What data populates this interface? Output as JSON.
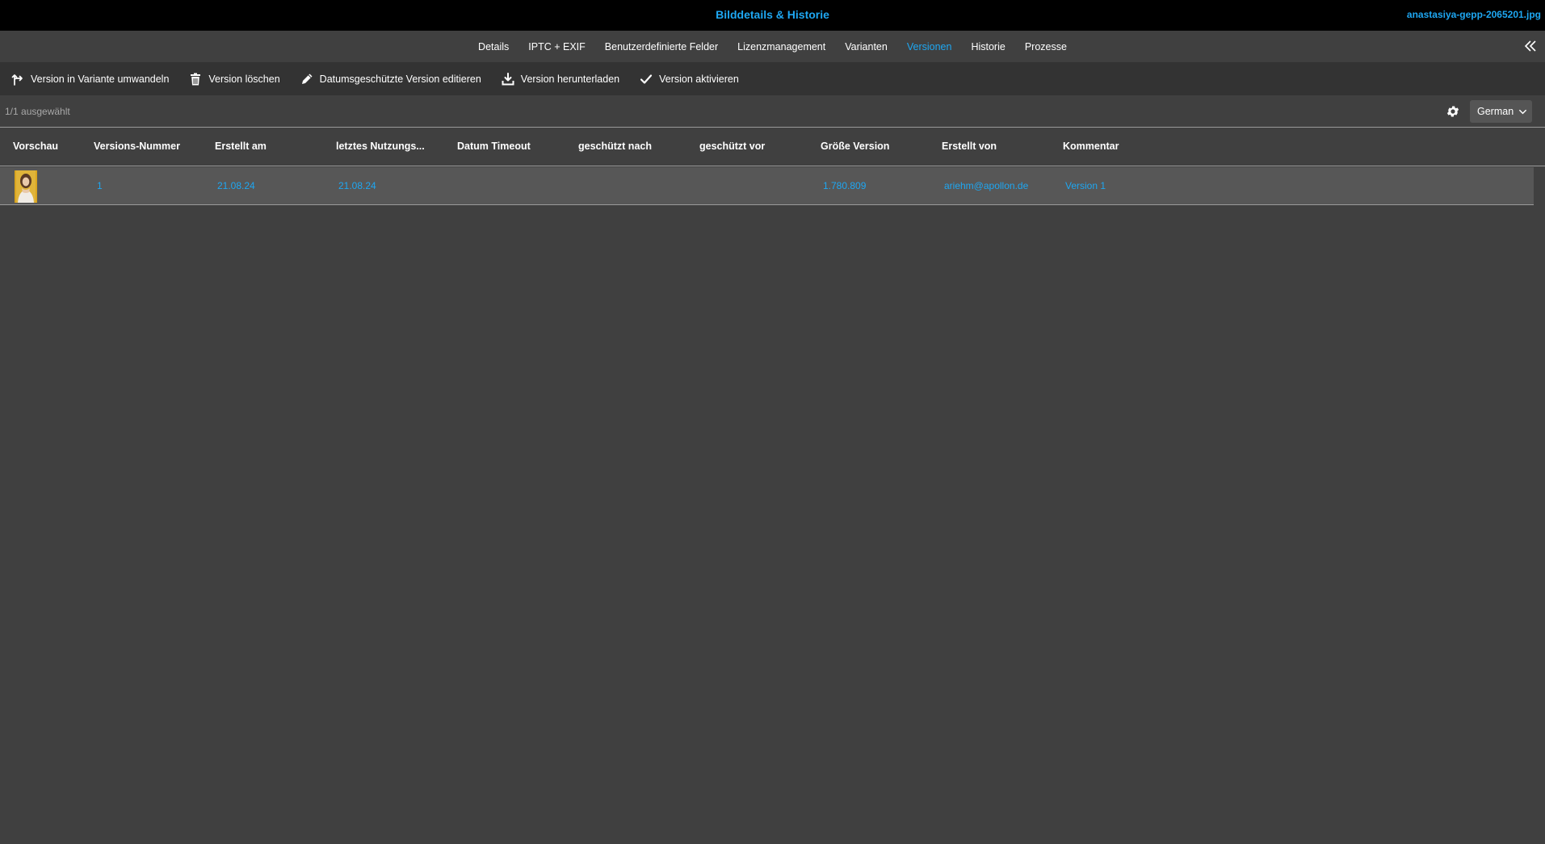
{
  "window": {
    "title": "Bilddetails & Historie",
    "filename": "anastasiya-gepp-2065201.jpg"
  },
  "tabs": [
    {
      "label": "Details",
      "active": false
    },
    {
      "label": "IPTC + EXIF",
      "active": false
    },
    {
      "label": "Benutzerdefinierte Felder",
      "active": false
    },
    {
      "label": "Lizenzmanagement",
      "active": false
    },
    {
      "label": "Varianten",
      "active": false
    },
    {
      "label": "Versionen",
      "active": true
    },
    {
      "label": "Historie",
      "active": false
    },
    {
      "label": "Prozesse",
      "active": false
    }
  ],
  "collapse_icon": "double-chevron-left-icon",
  "toolbar": {
    "convert_label": "Version in Variante umwandeln",
    "delete_label": "Version löschen",
    "edit_label": "Datumsgeschützte Version editieren",
    "download_label": "Version herunterladen",
    "activate_label": "Version aktivieren"
  },
  "status": {
    "selected": "1/1 ausgewählt",
    "language": "German"
  },
  "table": {
    "columns": [
      "Vorschau",
      "Versions-Nummer",
      "Erstellt am",
      "letztes Nutzungs...",
      "Datum Timeout",
      "geschützt nach",
      "geschützt vor",
      "Größe Version",
      "Erstellt von",
      "Kommentar"
    ],
    "rows": [
      {
        "preview": "thumbnail",
        "version_number": "1",
        "created_at": "21.08.24",
        "last_used": "21.08.24",
        "timeout": "",
        "protected_after": "",
        "protected_before": "",
        "size": "1.780.809",
        "created_by": "ariehm@apollon.de",
        "comment": "Version 1"
      }
    ]
  },
  "colors": {
    "accent": "#1ea7f2",
    "background": "#404040",
    "titlebar": "#000000",
    "toolbar": "#333333",
    "selected_row": "#575757"
  }
}
